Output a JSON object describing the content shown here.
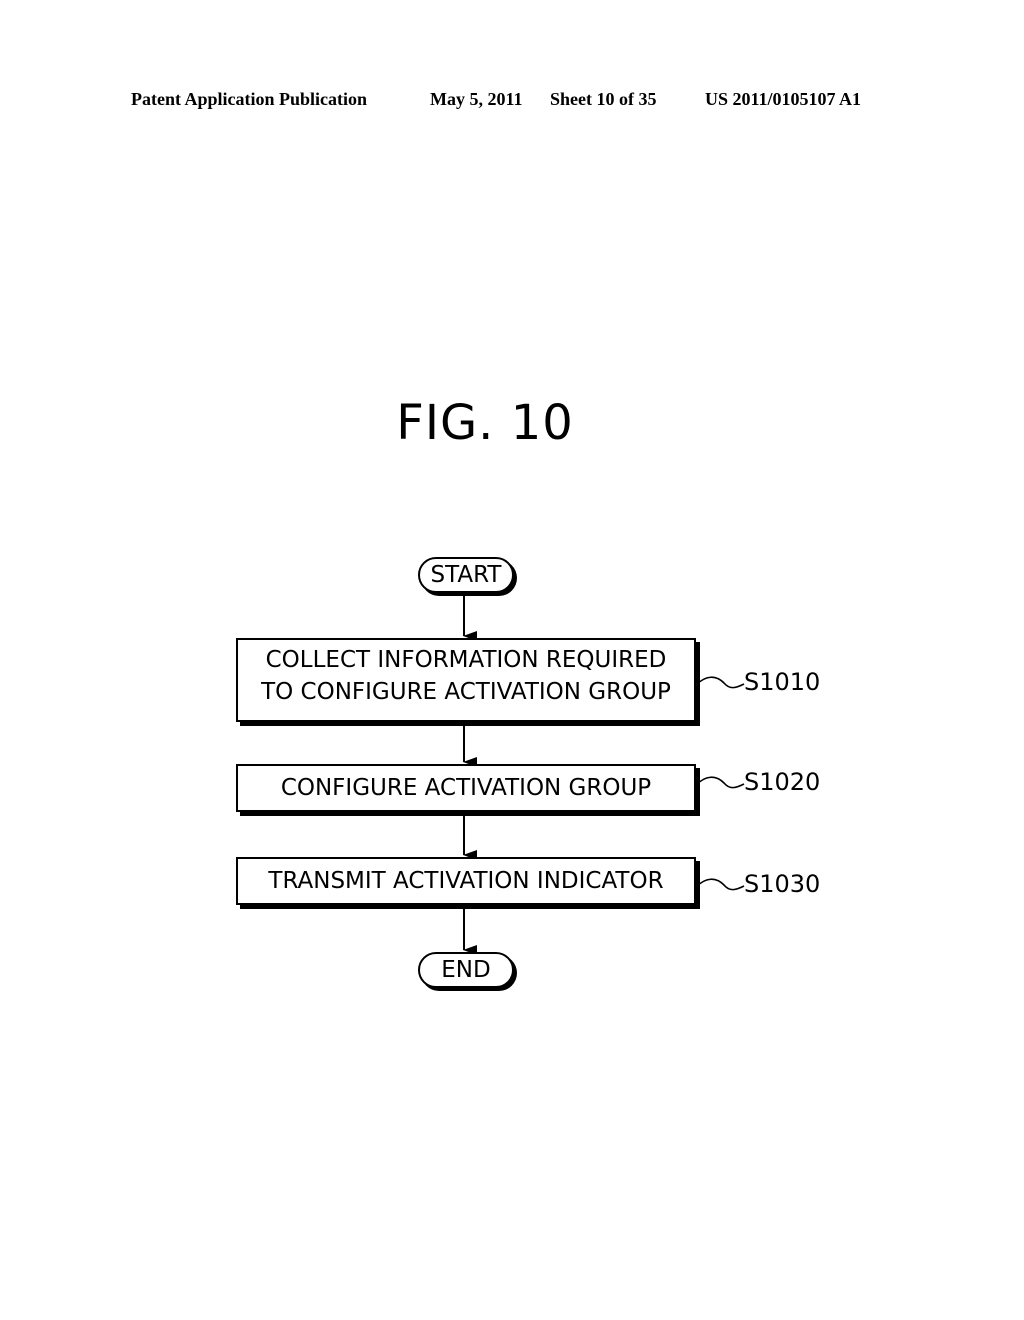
{
  "header": {
    "publication": "Patent Application Publication",
    "date": "May 5, 2011",
    "sheet": "Sheet 10 of 35",
    "number": "US 2011/0105107 A1"
  },
  "figure": {
    "title": "FIG. 10"
  },
  "flowchart": {
    "start": "START",
    "end": "END",
    "steps": [
      {
        "lines": [
          "COLLECT INFORMATION REQUIRED",
          "TO CONFIGURE ACTIVATION GROUP"
        ],
        "label": "S1010"
      },
      {
        "lines": [
          "CONFIGURE ACTIVATION GROUP"
        ],
        "label": "S1020"
      },
      {
        "lines": [
          "TRANSMIT ACTIVATION INDICATOR"
        ],
        "label": "S1030"
      }
    ]
  }
}
